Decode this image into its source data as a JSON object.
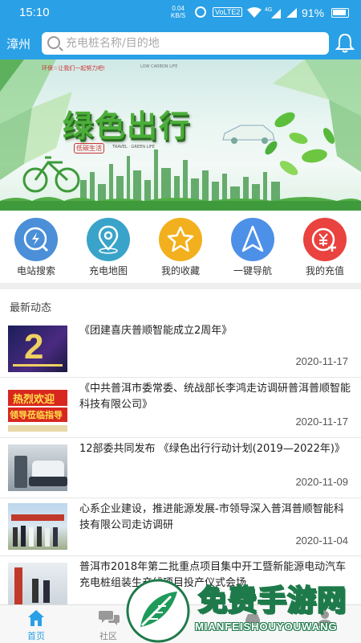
{
  "status_bar": {
    "time": "15:10",
    "net_speed_value": "0.04",
    "net_speed_unit": "KB/S",
    "volte": "VoLTE2",
    "battery_percent": "91%"
  },
  "header": {
    "city": "漳州",
    "search_placeholder": "充电桩名称/目的地"
  },
  "banner": {
    "slogan": "环保☆让我们一起努力吧!",
    "slogan_en": "LOW CARBON LIFE",
    "title": "绿色出行",
    "stamp": "低碳生活",
    "subtitle": "TRAVEL · GREEN LIFE"
  },
  "quick_nav": [
    {
      "label": "电站搜索",
      "icon": "lightning-search-icon",
      "color": "#4a8fd8"
    },
    {
      "label": "充电地图",
      "icon": "map-pin-icon",
      "color": "#3aa3c9"
    },
    {
      "label": "我的收藏",
      "icon": "star-icon",
      "color": "#f2b01e"
    },
    {
      "label": "一键导航",
      "icon": "navigation-arrow-icon",
      "color": "#4d90e8"
    },
    {
      "label": "我的充值",
      "icon": "yen-plus-icon",
      "color": "#e9423f"
    }
  ],
  "news_section": {
    "title": "最新动态"
  },
  "news": [
    {
      "title": "《团建喜庆普顺智能成立2周年》",
      "date": "2020-11-17"
    },
    {
      "title": "《中共普洱市委常委、统战部长李鸿走访调研普洱普顺智能科技有限公司》",
      "date": "2020-11-17"
    },
    {
      "title": "12部委共同发布 《绿色出行行动计划(2019—2022年)》",
      "date": "2020-11-09"
    },
    {
      "title": "心系企业建设，推进能源发展-市领导深入普洱普顺智能科技有限公司走访调研",
      "date": "2020-11-04"
    },
    {
      "title": "普洱市2018年第二批重点项目集中开工暨新能源电动汽车充电桩组装生产线项目投产仪式会场",
      "date": ""
    }
  ],
  "thumb_text": {
    "thumb1_big": "2",
    "thumb2_line1": "热烈欢迎",
    "thumb2_line2": "领导莅临指导"
  },
  "tab_bar": [
    {
      "label": "首页",
      "icon": "home-icon",
      "active": true
    },
    {
      "label": "社区",
      "icon": "chat-bubbles-icon",
      "active": false
    },
    {
      "label": "",
      "icon": "center-icon",
      "active": false
    },
    {
      "label": "",
      "icon": "car-icon",
      "active": false
    },
    {
      "label": "",
      "icon": "user-icon",
      "active": false
    }
  ],
  "watermark": {
    "text": "免费手游网",
    "sub": "MIANFEISHOUYOUWANG"
  },
  "colors": {
    "primary": "#2aa0e6",
    "banner_green": "#4cae3a"
  }
}
